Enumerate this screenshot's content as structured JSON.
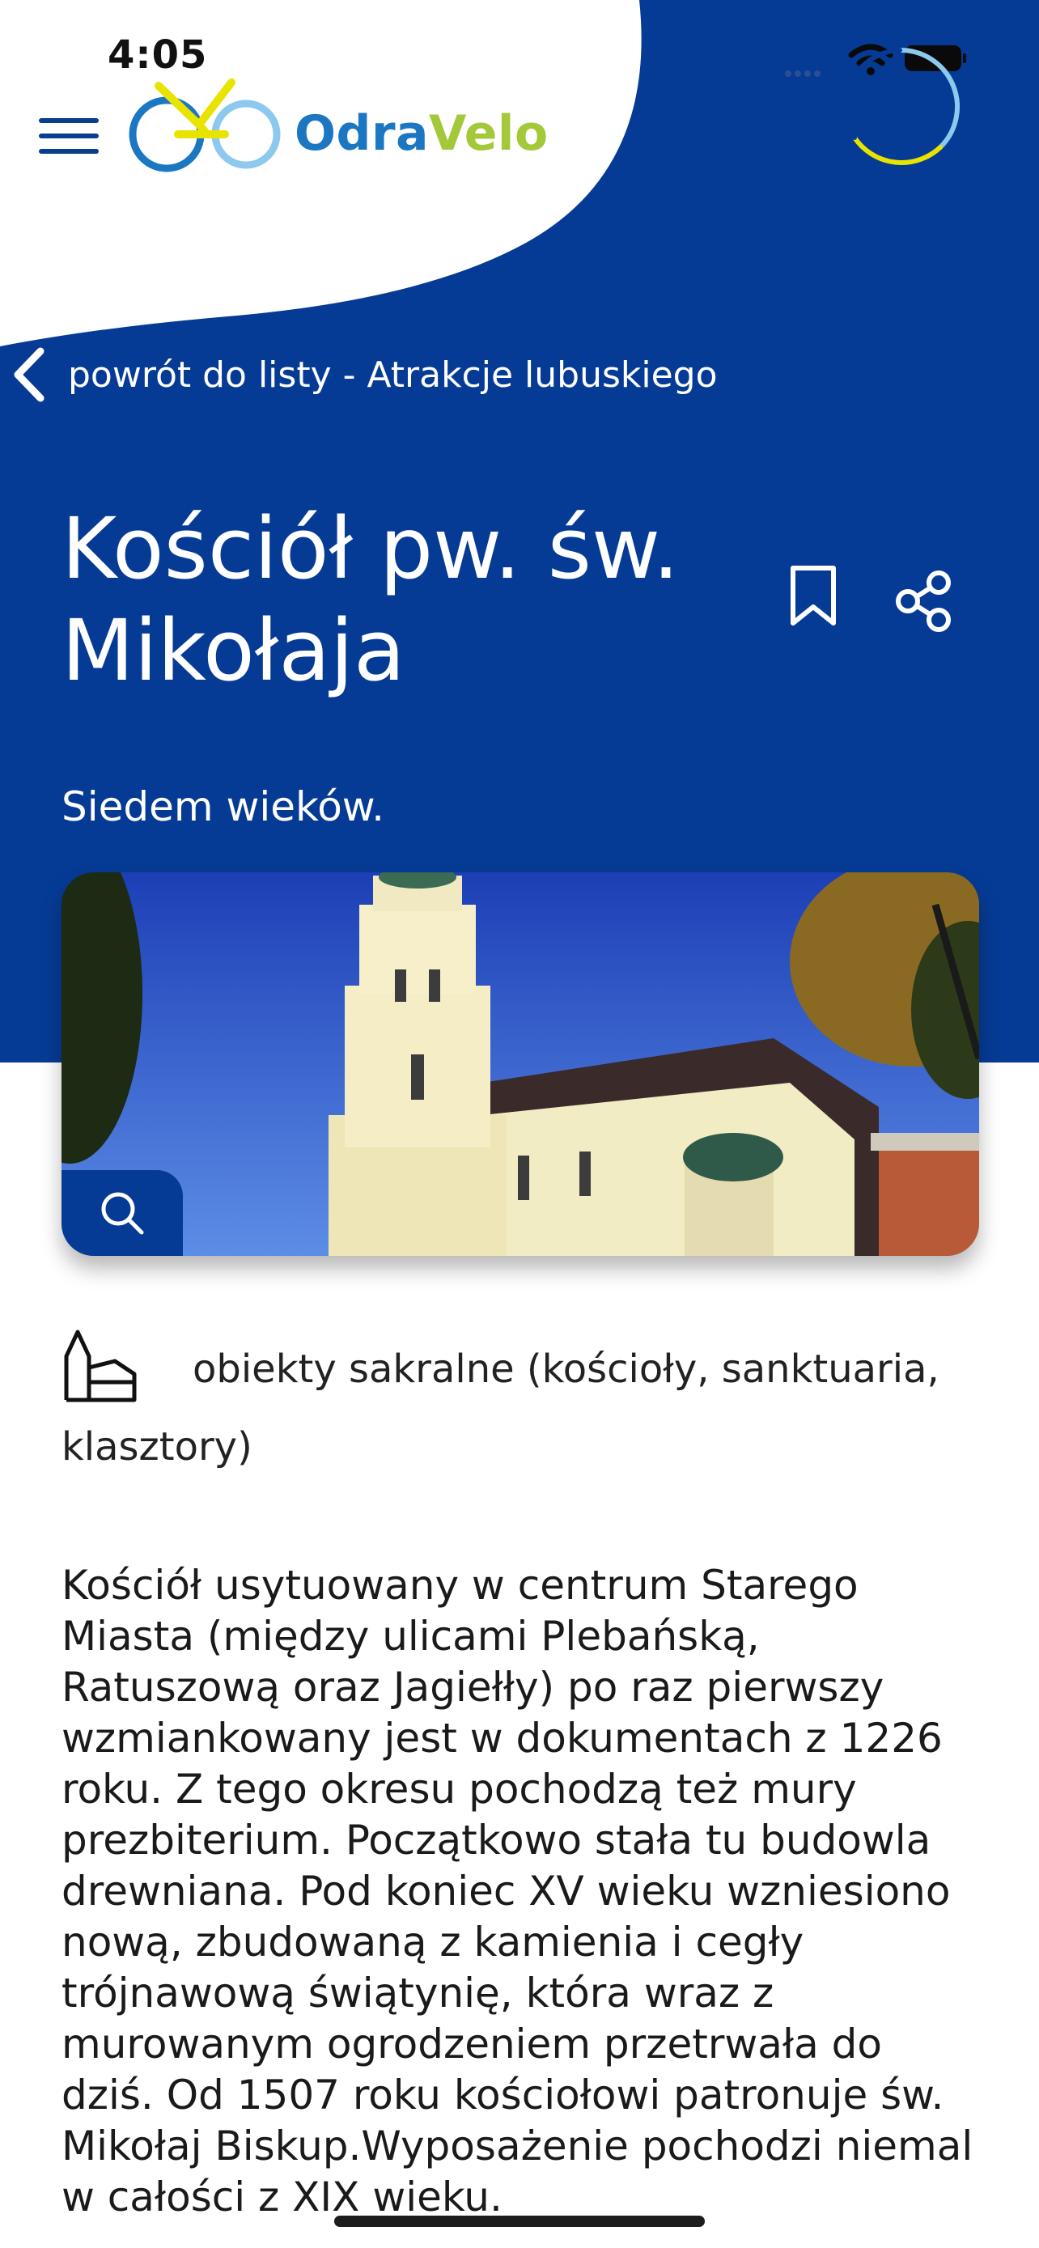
{
  "status_bar": {
    "time": "4:05"
  },
  "header": {
    "logo_part1": "Odra",
    "logo_part2": "Velo",
    "menu_icon": "hamburger-icon",
    "account_icon": "user-icon"
  },
  "nav": {
    "back_label": "powrót do listy - Atrakcje lubuskiego"
  },
  "detail": {
    "title": "Kościół pw. św. Mikołaja",
    "subtitle": "Siedem wieków.",
    "category": "obiekty sakralne (kościoły, sanktuaria, klasztory)",
    "description": "Kościół usytuowany w centrum Starego Miasta (między ulicami Plebańską, Ratuszową oraz Jagiełły) po raz pierwszy wzmiankowany jest w dokumentach z 1226 roku. Z tego okresu pochodzą też mury prezbiterium. Początkowo stała tu budowla drewniana. Pod koniec XV wieku wzniesiono nową, zbudowaną z kamienia i cegły trójnawową świątynię, która wraz z murowanym ogrodzeniem przetrwała do dziś. Od 1507 roku kościołowi patronuje św. Mikołaj Biskup.Wyposażenie pochodzi niemal w całości z XIX wieku."
  },
  "colors": {
    "brand_blue": "#063b95",
    "logo_blue": "#1c77c3",
    "logo_green": "#a3c93a",
    "logo_yellow": "#e9e300",
    "logo_light_blue": "#8dc8ee"
  }
}
